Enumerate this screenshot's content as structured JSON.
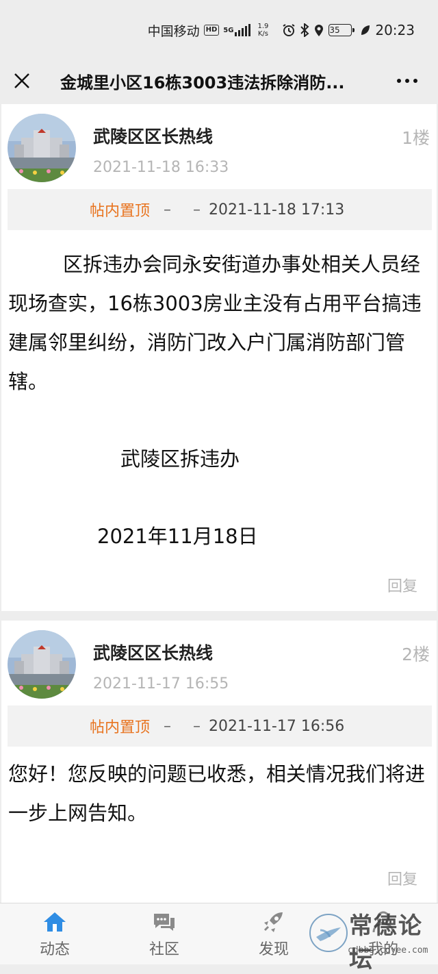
{
  "status_bar": {
    "carrier": "中国移动",
    "hd": "HD",
    "net_gen": "5G",
    "net_speed": "1.9",
    "net_unit": "K/s",
    "battery": "35",
    "time": "20:23"
  },
  "title_bar": {
    "title": "金城里小区16栋3003违法拆除消防..."
  },
  "posts": [
    {
      "author": "武陵区区长热线",
      "time": "2021-11-18 16:33",
      "floor": "1楼",
      "pin_label": "帖内置顶",
      "pin_dash1": "–",
      "pin_dash2": "–",
      "pin_time": "2021-11-18 17:13",
      "paragraphs": [
        "区拆违办会同永安街道办事处相关人员经现场查实，16栋3003房业主没有占用平台搞违建属邻里纠纷，消防门改入户门属消防部门管辖。"
      ],
      "signature": "武陵区拆违办",
      "date": "2021年11月18日",
      "reply": "回复"
    },
    {
      "author": "武陵区区长热线",
      "time": "2021-11-17 16:55",
      "floor": "2楼",
      "pin_label": "帖内置顶",
      "pin_dash1": "–",
      "pin_dash2": "–",
      "pin_time": "2021-11-17 16:56",
      "paragraphs": [
        "您好！您反映的问题已收悉，相关情况我们将进一步上网告知。"
      ],
      "reply": "回复"
    }
  ],
  "tab_bar": {
    "tabs": [
      {
        "label": "动态",
        "icon": "home-icon",
        "active": true
      },
      {
        "label": "社区",
        "icon": "chat-icon",
        "active": false
      },
      {
        "label": "发现",
        "icon": "rocket-icon",
        "active": false
      },
      {
        "label": "我的",
        "icon": "user-icon",
        "active": false
      }
    ]
  },
  "watermark": {
    "text": "常德论坛",
    "url": "cdbbs.cdyee.com"
  },
  "colors": {
    "accent_orange": "#e8731e",
    "tab_active_blue": "#2f8de4",
    "muted_gray": "#b5b5b5"
  }
}
